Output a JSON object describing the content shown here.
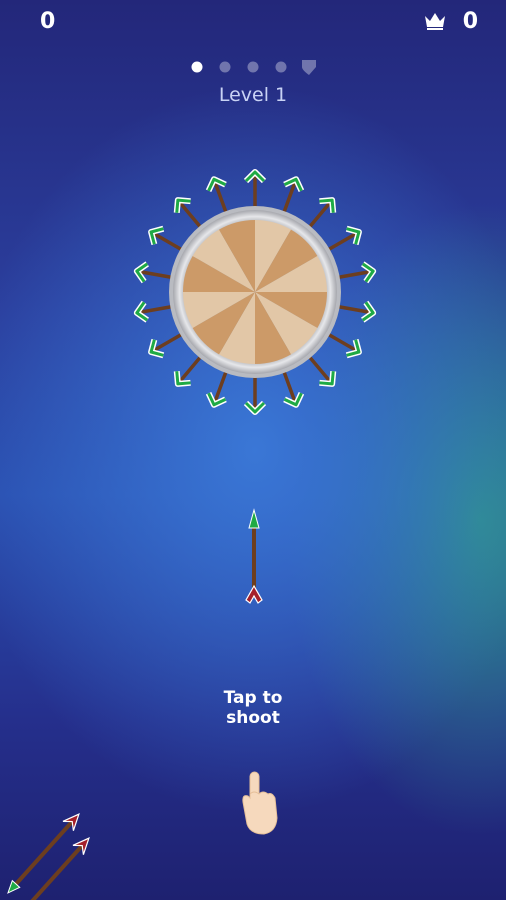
{
  "hud": {
    "score": "0",
    "best_score": "0",
    "crown_icon": "crown-icon"
  },
  "progress": {
    "total_stages": 4,
    "current_stage": 1,
    "boss_icon": "shield-icon"
  },
  "level_label": "Level 1",
  "board": {
    "stuck_arrows": 18,
    "wood_segments": 12
  },
  "arrow_ready": true,
  "remaining_arrows": 2,
  "hint": {
    "line1": "Tap to",
    "line2": "shoot",
    "hand_icon": "tap-hand-icon"
  },
  "colors": {
    "wood_light": "#e2c7a7",
    "wood_dark": "#cc9a68",
    "rim": "#c9c9cc",
    "shaft": "#6d3e1f",
    "fletch": "#1faa45",
    "tip_red": "#a5202a"
  }
}
